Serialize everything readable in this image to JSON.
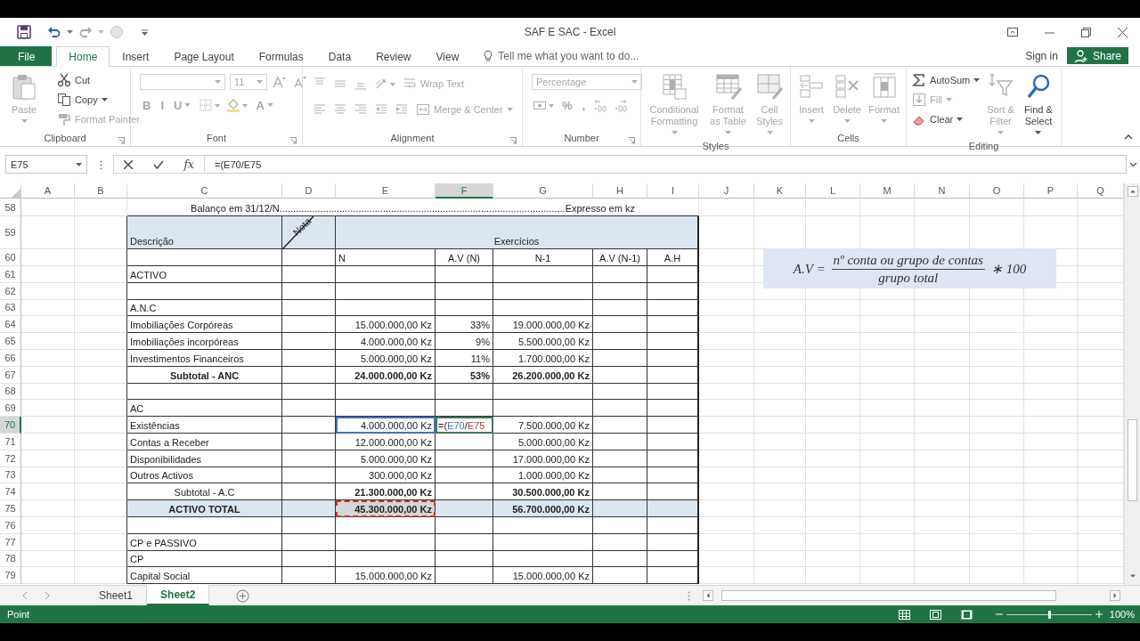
{
  "window": {
    "title": "SAF E SAC - Excel"
  },
  "menu_tabs": [
    {
      "label": "File",
      "kind": "file",
      "selected": false
    },
    {
      "label": "Home",
      "kind": "tab",
      "selected": true
    },
    {
      "label": "Insert",
      "kind": "tab",
      "selected": false
    },
    {
      "label": "Page Layout",
      "kind": "tab",
      "selected": false
    },
    {
      "label": "Formulas",
      "kind": "tab",
      "selected": false
    },
    {
      "label": "Data",
      "kind": "tab",
      "selected": false
    },
    {
      "label": "Review",
      "kind": "tab",
      "selected": false
    },
    {
      "label": "View",
      "kind": "tab",
      "selected": false
    }
  ],
  "tell_me": {
    "placeholder": "Tell me what you want to do..."
  },
  "account": {
    "sign_in": "Sign in",
    "share": "Share"
  },
  "ribbon": {
    "groups": [
      {
        "label": "Clipboard",
        "kind": "stack",
        "launcher": true,
        "items": [
          {
            "kind": "large",
            "label": "Paste",
            "disabled": true
          },
          {
            "kind": "small",
            "label": "Cut",
            "disabled": false
          },
          {
            "kind": "small",
            "label": "Copy",
            "disabled": false
          },
          {
            "kind": "small",
            "label": "Format Painter",
            "disabled": true
          }
        ]
      },
      {
        "label": "Font",
        "kind": "rows",
        "launcher": true,
        "rows": [
          [
            {
              "kind": "combo",
              "disabled": true
            },
            {
              "kind": "combo",
              "value": "11",
              "disabled": true
            },
            {
              "kind": "icon",
              "disabled": true
            },
            {
              "kind": "icon",
              "disabled": true
            }
          ],
          [
            {
              "kind": "glyph",
              "label": "B",
              "disabled": true
            },
            {
              "kind": "glyph",
              "label": "I",
              "disabled": true
            },
            {
              "kind": "glyph",
              "label": "U",
              "disabled": true
            },
            {
              "kind": "icon",
              "disabled": true
            },
            {
              "kind": "icon",
              "disabled": true
            },
            {
              "kind": "glyph",
              "label": "A",
              "disabled": true
            }
          ]
        ]
      },
      {
        "label": "Alignment",
        "kind": "rows",
        "launcher": true,
        "rows": [
          [
            {
              "kind": "icon",
              "disabled": true
            },
            {
              "kind": "icon",
              "disabled": true
            },
            {
              "kind": "icon",
              "disabled": true
            },
            {
              "kind": "icon",
              "disabled": true
            },
            {
              "kind": "small",
              "label": "Wrap Text",
              "disabled": true
            }
          ],
          [
            {
              "kind": "icon",
              "disabled": true
            },
            {
              "kind": "icon",
              "disabled": true
            },
            {
              "kind": "icon",
              "disabled": true
            },
            {
              "kind": "icon",
              "disabled": true
            },
            {
              "kind": "icon",
              "disabled": true
            },
            {
              "kind": "small",
              "label": "Merge & Center",
              "disabled": true
            }
          ]
        ]
      },
      {
        "label": "Number",
        "kind": "rows",
        "launcher": true,
        "rows": [
          [
            {
              "kind": "combo",
              "value": "Percentage",
              "disabled": true
            }
          ],
          [
            {
              "kind": "icon",
              "disabled": true
            },
            {
              "kind": "glyph",
              "label": "%",
              "disabled": true
            },
            {
              "kind": "glyph",
              "label": ",",
              "disabled": true
            },
            {
              "kind": "icon",
              "disabled": true
            },
            {
              "kind": "icon",
              "disabled": true
            }
          ]
        ]
      },
      {
        "label": "Styles",
        "kind": "stack",
        "launcher": false,
        "items": [
          {
            "kind": "large",
            "label": "Conditional Formatting",
            "disabled": true
          },
          {
            "kind": "large",
            "label": "Format as Table",
            "disabled": true
          },
          {
            "kind": "large",
            "label": "Cell Styles",
            "disabled": true
          }
        ]
      },
      {
        "label": "Cells",
        "kind": "stack",
        "launcher": false,
        "items": [
          {
            "kind": "large",
            "label": "Insert",
            "disabled": true
          },
          {
            "kind": "large",
            "label": "Delete",
            "disabled": true
          },
          {
            "kind": "large",
            "label": "Format",
            "disabled": true
          }
        ]
      },
      {
        "label": "Editing",
        "kind": "stack",
        "launcher": false,
        "items": [
          {
            "kind": "small",
            "label": "AutoSum",
            "disabled": false
          },
          {
            "kind": "small",
            "label": "Fill",
            "disabled": true
          },
          {
            "kind": "small",
            "label": "Clear",
            "disabled": false
          },
          {
            "kind": "large",
            "label": "Sort & Filter",
            "disabled": true
          },
          {
            "kind": "large",
            "label": "Find & Select",
            "disabled": false
          }
        ]
      }
    ]
  },
  "formula_bar": {
    "name_box": "E75",
    "function_label": "fx",
    "formula": "=(E70/E75"
  },
  "sheet": {
    "columns": [
      {
        "letter": "A",
        "selected": false
      },
      {
        "letter": "B",
        "selected": false
      },
      {
        "letter": "C",
        "selected": false
      },
      {
        "letter": "D",
        "selected": false
      },
      {
        "letter": "E",
        "selected": false
      },
      {
        "letter": "F",
        "selected": true
      },
      {
        "letter": "G",
        "selected": false
      },
      {
        "letter": "H",
        "selected": false
      },
      {
        "letter": "I",
        "selected": false
      },
      {
        "letter": "J",
        "selected": false
      },
      {
        "letter": "K",
        "selected": false
      },
      {
        "letter": "L",
        "selected": false
      },
      {
        "letter": "M",
        "selected": false
      },
      {
        "letter": "N",
        "selected": false
      },
      {
        "letter": "O",
        "selected": false
      },
      {
        "letter": "P",
        "selected": false
      },
      {
        "letter": "Q",
        "selected": false
      }
    ],
    "rows": [
      {
        "number": "58",
        "kind": "title",
        "selected": false,
        "cells": {
          "C": {
            "text": "Balanço em 31/12/N.........................................................................................................Expresso em kz"
          }
        }
      },
      {
        "number": "59",
        "kind": "header",
        "selected": false,
        "cells": {
          "C": {
            "text": "Descrição"
          },
          "D": {
            "text": "Nota"
          },
          "E": {
            "text": "Exercícios"
          }
        }
      },
      {
        "number": "60",
        "kind": "subheader",
        "selected": false,
        "cells": {
          "E": {
            "text": "N"
          },
          "F": {
            "text": "A.V (N)"
          },
          "G": {
            "text": "N-1"
          },
          "H": {
            "text": "A.V (N-1)"
          },
          "I": {
            "text": "A.H"
          }
        }
      },
      {
        "number": "61",
        "kind": "item",
        "selected": false,
        "cells": {
          "C": {
            "text": "ACTIVO"
          }
        }
      },
      {
        "number": "62",
        "kind": "item",
        "selected": false,
        "cells": {}
      },
      {
        "number": "63",
        "kind": "item",
        "selected": false,
        "cells": {
          "C": {
            "text": "A.N.C"
          }
        }
      },
      {
        "number": "64",
        "kind": "item",
        "selected": false,
        "cells": {
          "C": {
            "text": "Imobiliações Corpóreas"
          },
          "E": {
            "text": "15.000.000,00 Kz"
          },
          "F": {
            "text": "33%"
          },
          "G": {
            "text": "19.000.000,00 Kz"
          }
        }
      },
      {
        "number": "65",
        "kind": "item",
        "selected": false,
        "cells": {
          "C": {
            "text": "Imobiliações incorpóreas"
          },
          "E": {
            "text": "4.000.000,00 Kz"
          },
          "F": {
            "text": "9%"
          },
          "G": {
            "text": "5.500.000,00 Kz"
          }
        }
      },
      {
        "number": "66",
        "kind": "item",
        "selected": false,
        "cells": {
          "C": {
            "text": "Investimentos Financeiros"
          },
          "E": {
            "text": "5.000.000,00 Kz"
          },
          "F": {
            "text": "11%"
          },
          "G": {
            "text": "1.700.000,00 Kz"
          }
        }
      },
      {
        "number": "67",
        "kind": "subtotal",
        "selected": false,
        "cells": {
          "C": {
            "text": "Subtotal - ANC"
          },
          "E": {
            "text": "24.000.000,00 Kz"
          },
          "F": {
            "text": "53%"
          },
          "G": {
            "text": "26.200.000,00 Kz"
          }
        }
      },
      {
        "number": "68",
        "kind": "item",
        "selected": false,
        "cells": {}
      },
      {
        "number": "69",
        "kind": "item",
        "selected": false,
        "cells": {
          "C": {
            "text": "AC"
          }
        }
      },
      {
        "number": "70",
        "kind": "item",
        "selected": true,
        "cells": {
          "C": {
            "text": "Existências"
          },
          "E": {
            "text": "4.000.000,00 Kz",
            "kind": "reference"
          },
          "F": {
            "text": "=(E70/E75",
            "kind": "editing"
          },
          "G": {
            "text": "7.500.000,00 Kz"
          }
        }
      },
      {
        "number": "71",
        "kind": "item",
        "selected": false,
        "cells": {
          "C": {
            "text": "Contas a Receber"
          },
          "E": {
            "text": "12.000.000,00 Kz"
          },
          "G": {
            "text": "5.000.000,00 Kz"
          }
        }
      },
      {
        "number": "72",
        "kind": "item",
        "selected": false,
        "cells": {
          "C": {
            "text": "Disponibilidades"
          },
          "E": {
            "text": "5.000.000,00 Kz"
          },
          "G": {
            "text": "17.000.000,00 Kz"
          }
        }
      },
      {
        "number": "73",
        "kind": "item",
        "selected": false,
        "cells": {
          "C": {
            "text": "Outros Activos"
          },
          "E": {
            "text": "300.000,00 Kz"
          },
          "G": {
            "text": "1.000.000,00 Kz"
          }
        }
      },
      {
        "number": "74",
        "kind": "sum",
        "selected": false,
        "cells": {
          "C": {
            "text": "Subtotal - A.C"
          },
          "E": {
            "text": "21.300.000,00 Kz"
          },
          "G": {
            "text": "30.500.000,00 Kz"
          }
        }
      },
      {
        "number": "75",
        "kind": "total",
        "selected": false,
        "cells": {
          "C": {
            "text": "ACTIVO TOTAL"
          },
          "E": {
            "text": "45.300.000,00 Kz",
            "kind": "copied"
          },
          "G": {
            "text": "56.700.000,00 Kz"
          }
        }
      },
      {
        "number": "76",
        "kind": "item",
        "selected": false,
        "cells": {}
      },
      {
        "number": "77",
        "kind": "item",
        "selected": false,
        "cells": {
          "C": {
            "text": "CP e PASSIVO"
          }
        }
      },
      {
        "number": "78",
        "kind": "item",
        "selected": false,
        "cells": {
          "C": {
            "text": "CP"
          }
        }
      },
      {
        "number": "79",
        "kind": "item",
        "selected": false,
        "cells": {
          "C": {
            "text": "Capital Social"
          },
          "E": {
            "text": "15.000.000,00 Kz"
          },
          "G": {
            "text": "15.000.000,00 Kz"
          }
        }
      }
    ]
  },
  "equation": {
    "lhs": "A.V =",
    "numerator": "nº conta ou grupo de contas",
    "denominator": "grupo total",
    "factor": "∗ 100"
  },
  "sheet_tabs": [
    {
      "label": "Sheet1",
      "selected": false
    },
    {
      "label": "Sheet2",
      "selected": true
    }
  ],
  "status_bar": {
    "mode": "Point",
    "zoom": "100%",
    "zoom_slider": {
      "level": 0.5
    }
  }
}
